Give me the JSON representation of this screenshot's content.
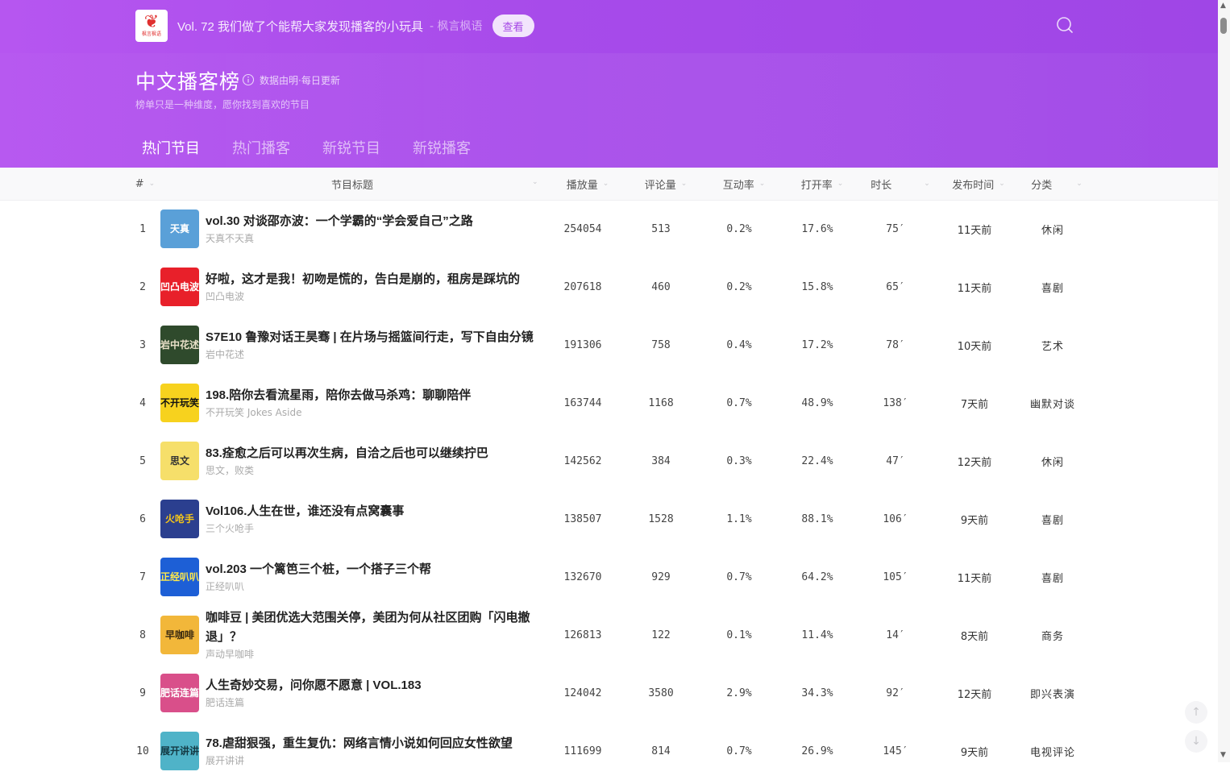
{
  "header": {
    "logo_text": "枫言枫语",
    "episode_title": "Vol. 72 我们做了个能帮大家发现播客的小玩具",
    "episode_source": "- 枫言枫语",
    "view_button": "查看",
    "search_icon": "search-icon"
  },
  "page": {
    "title": "中文播客榜",
    "data_note": "数据由明·每日更新",
    "subtitle": "榜单只是一种维度，愿你找到喜欢的节目"
  },
  "tabs": [
    {
      "label": "热门节目",
      "active": true
    },
    {
      "label": "热门播客",
      "active": false
    },
    {
      "label": "新锐节目",
      "active": false
    },
    {
      "label": "新锐播客",
      "active": false
    }
  ],
  "columns": {
    "rank": "#",
    "title": "节目标题",
    "plays": "播放量",
    "comments": "评论量",
    "interaction": "互动率",
    "open_rate": "打开率",
    "duration": "时长",
    "published": "发布时间",
    "category": "分类"
  },
  "rows": [
    {
      "rank": "1",
      "title": "vol.30 对谈邵亦波：一个学霸的“学会爱自己”之路",
      "podcast": "天真不天真",
      "plays": "254054",
      "comments": "513",
      "interaction": "0.2%",
      "open_rate": "17.6%",
      "duration": "75′",
      "published": "11天前",
      "category": "休闲",
      "cover_text": "天真",
      "cover_bg": "#5aa0d8",
      "cover_fg": "#ffffff"
    },
    {
      "rank": "2",
      "title": "好啦，这才是我！初吻是慌的，告白是崩的，租房是踩坑的",
      "podcast": "凹凸电波",
      "plays": "207618",
      "comments": "460",
      "interaction": "0.2%",
      "open_rate": "15.8%",
      "duration": "65′",
      "published": "11天前",
      "category": "喜剧",
      "cover_text": "凹凸电波",
      "cover_bg": "#e8202a",
      "cover_fg": "#ffffff"
    },
    {
      "rank": "3",
      "title": "S7E10 鲁豫对话王昊骞 | 在片场与摇篮间行走，写下自由分镜",
      "podcast": "岩中花述",
      "plays": "191306",
      "comments": "758",
      "interaction": "0.4%",
      "open_rate": "17.2%",
      "duration": "78′",
      "published": "10天前",
      "category": "艺术",
      "cover_text": "岩中花述",
      "cover_bg": "#2f4a2c",
      "cover_fg": "#e8e0c8"
    },
    {
      "rank": "4",
      "title": "198.陪你去看流星雨，陪你去做马杀鸡：聊聊陪伴",
      "podcast": "不开玩笑 Jokes Aside",
      "plays": "163744",
      "comments": "1168",
      "interaction": "0.7%",
      "open_rate": "48.9%",
      "duration": "138′",
      "published": "7天前",
      "category": "幽默对谈",
      "cover_text": "不开玩笑",
      "cover_bg": "#f7d21e",
      "cover_fg": "#111111"
    },
    {
      "rank": "5",
      "title": "83.痊愈之后可以再次生病，自洽之后也可以继续拧巴",
      "podcast": "思文，败类",
      "plays": "142562",
      "comments": "384",
      "interaction": "0.3%",
      "open_rate": "22.4%",
      "duration": "47′",
      "published": "12天前",
      "category": "休闲",
      "cover_text": "思文",
      "cover_bg": "#f6df6a",
      "cover_fg": "#333333"
    },
    {
      "rank": "6",
      "title": "Vol106.人生在世，谁还没有点窝囊事",
      "podcast": "三个火呛手",
      "plays": "138507",
      "comments": "1528",
      "interaction": "1.1%",
      "open_rate": "88.1%",
      "duration": "106′",
      "published": "9天前",
      "category": "喜剧",
      "cover_text": "火呛手",
      "cover_bg": "#2b3f8f",
      "cover_fg": "#f5c518"
    },
    {
      "rank": "7",
      "title": "vol.203 一个篱笆三个桩，一个搭子三个帮",
      "podcast": "正经叭叭",
      "plays": "132670",
      "comments": "929",
      "interaction": "0.7%",
      "open_rate": "64.2%",
      "duration": "105′",
      "published": "11天前",
      "category": "喜剧",
      "cover_text": "正经叭叭",
      "cover_bg": "#1d5fd6",
      "cover_fg": "#ffe94a"
    },
    {
      "rank": "8",
      "title": "咖啡豆 | 美团优选大范围关停，美团为何从社区团购「闪电撤退」？",
      "podcast": "声动早咖啡",
      "plays": "126813",
      "comments": "122",
      "interaction": "0.1%",
      "open_rate": "11.4%",
      "duration": "14′",
      "published": "8天前",
      "category": "商务",
      "cover_text": "早咖啡",
      "cover_bg": "#f2b73a",
      "cover_fg": "#3a2a10"
    },
    {
      "rank": "9",
      "title": "人生奇妙交易，问你愿不愿意 | VOL.183",
      "podcast": "肥话连篇",
      "plays": "124042",
      "comments": "3580",
      "interaction": "2.9%",
      "open_rate": "34.3%",
      "duration": "92′",
      "published": "12天前",
      "category": "即兴表演",
      "cover_text": "肥话连篇",
      "cover_bg": "#d94f8a",
      "cover_fg": "#ffffff"
    },
    {
      "rank": "10",
      "title": "78.虐甜狠强，重生复仇：网络言情小说如何回应女性欲望",
      "podcast": "展开讲讲",
      "plays": "111699",
      "comments": "814",
      "interaction": "0.7%",
      "open_rate": "26.9%",
      "duration": "145′",
      "published": "9天前",
      "category": "电视评论",
      "cover_text": "展开讲讲",
      "cover_bg": "#4fb3c8",
      "cover_fg": "#143a44"
    }
  ],
  "floating": {
    "up": "↑",
    "down": "↓"
  }
}
